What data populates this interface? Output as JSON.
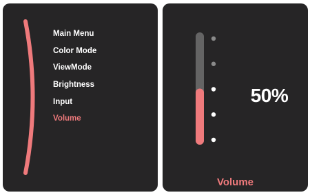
{
  "theme": {
    "panel_bg": "#262526",
    "accent": "#ef7a7c",
    "text": "#ffffff",
    "track": "#646464",
    "dot_inactive": "#8a8a8a",
    "dot_active": "#ffffff"
  },
  "menu": {
    "items": [
      {
        "label": "Main Menu",
        "active": false
      },
      {
        "label": "Color Mode",
        "active": false
      },
      {
        "label": "ViewMode",
        "active": false
      },
      {
        "label": "Brightness",
        "active": false
      },
      {
        "label": "Input",
        "active": false
      },
      {
        "label": "Volume",
        "active": true
      }
    ]
  },
  "volume": {
    "value_text": "50%",
    "level": 0.5,
    "steps": 5,
    "caption": "Volume"
  }
}
